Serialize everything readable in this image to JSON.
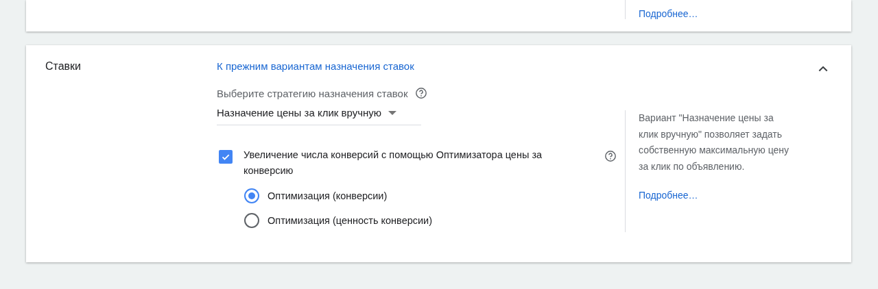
{
  "top_card": {
    "help_link": "Подробнее…"
  },
  "bids_card": {
    "title": "Ставки",
    "expanded": true,
    "legacy_link": "К прежним вариантам назначения ставок",
    "strategy_label": "Выберите стратегию назначения ставок",
    "strategy_value": "Назначение цены за клик вручную",
    "enhanced_cpc": {
      "label": "Увеличение числа конверсий с помощью Оптимизатора цены за конверсию",
      "checked": true
    },
    "options": [
      {
        "label": "Оптимизация (конверсии)",
        "selected": true
      },
      {
        "label": "Оптимизация (ценность конверсии)",
        "selected": false
      }
    ],
    "help_text": "Вариант \"Назначение цены за клик вручную\" позволяет задать собственную максимальную цену за клик по объявлению.",
    "help_link": "Подробнее…"
  }
}
